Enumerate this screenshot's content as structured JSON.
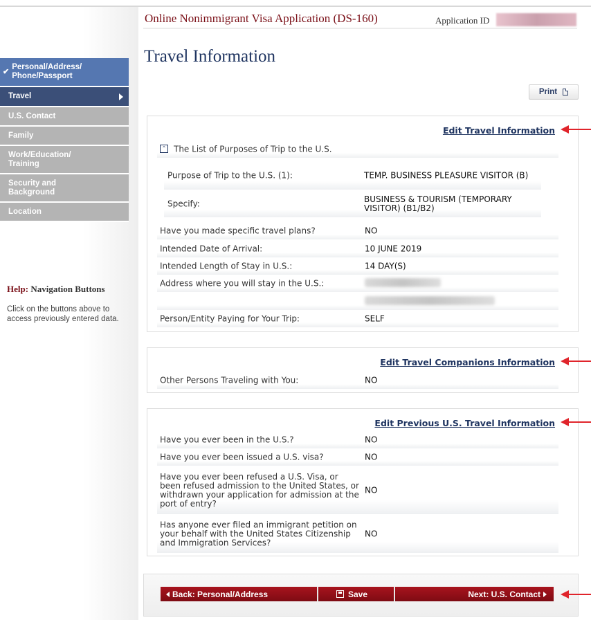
{
  "header": {
    "app_title": "Online Nonimmigrant Visa Application (DS-160)",
    "application_id_label": "Application ID"
  },
  "page": {
    "title": "Travel Information",
    "print_label": "Print"
  },
  "sidebar": {
    "items": [
      {
        "label": "Personal/Address/ Phone/Passport",
        "state": "done"
      },
      {
        "label": "Travel",
        "state": "current"
      },
      {
        "label": "U.S. Contact",
        "state": "pending"
      },
      {
        "label": "Family",
        "state": "pending"
      },
      {
        "label": "Work/Education/ Training",
        "state": "pending"
      },
      {
        "label": "Security and Background",
        "state": "pending"
      },
      {
        "label": "Location",
        "state": "pending"
      }
    ],
    "help": {
      "title_prefix": "Help:",
      "title_rest": "Navigation Buttons",
      "text": "Click on the buttons above to access previously entered data."
    }
  },
  "travel": {
    "edit_label": "Edit Travel Information",
    "list_header": "The List of Purposes of Trip to the U.S.",
    "purpose_label": "Purpose of Trip to the U.S. (1):",
    "purpose_value": "TEMP. BUSINESS PLEASURE VISITOR (B)",
    "specify_label": "Specify:",
    "specify_value": "BUSINESS & TOURISM (TEMPORARY VISITOR) (B1/B2)",
    "plans_label": "Have you made specific travel plans?",
    "plans_value": "NO",
    "arrival_label": "Intended Date of Arrival:",
    "arrival_value": "10 JUNE 2019",
    "length_label": "Intended Length of Stay in U.S.:",
    "length_value": "14 DAY(S)",
    "address_label": "Address where you will stay in the U.S.:",
    "payer_label": "Person/Entity Paying for Your Trip:",
    "payer_value": "SELF"
  },
  "companions": {
    "edit_label": "Edit Travel Companions Information",
    "others_label": "Other Persons Traveling with You:",
    "others_value": "NO"
  },
  "previous": {
    "edit_label": "Edit Previous U.S. Travel Information",
    "q1_label": "Have you ever been in the U.S.?",
    "q1_value": "NO",
    "q2_label": "Have you ever been issued a U.S. visa?",
    "q2_value": "NO",
    "q3_label": "Have you ever been refused a U.S. Visa, or been refused admission to the United States, or withdrawn your application for admission at the port of entry?",
    "q3_value": "NO",
    "q4_label": "Has anyone ever filed an immigrant petition on your behalf with the United States Citizenship and Immigration Services?",
    "q4_value": "NO"
  },
  "navigation": {
    "back_label": "Back: Personal/Address",
    "save_label": "Save",
    "next_label": "Next: U.S. Contact"
  },
  "colors": {
    "brand_red": "#7a0f17",
    "nav_blue": "#3b4f78",
    "annotation_arrow": "#e0242b"
  }
}
